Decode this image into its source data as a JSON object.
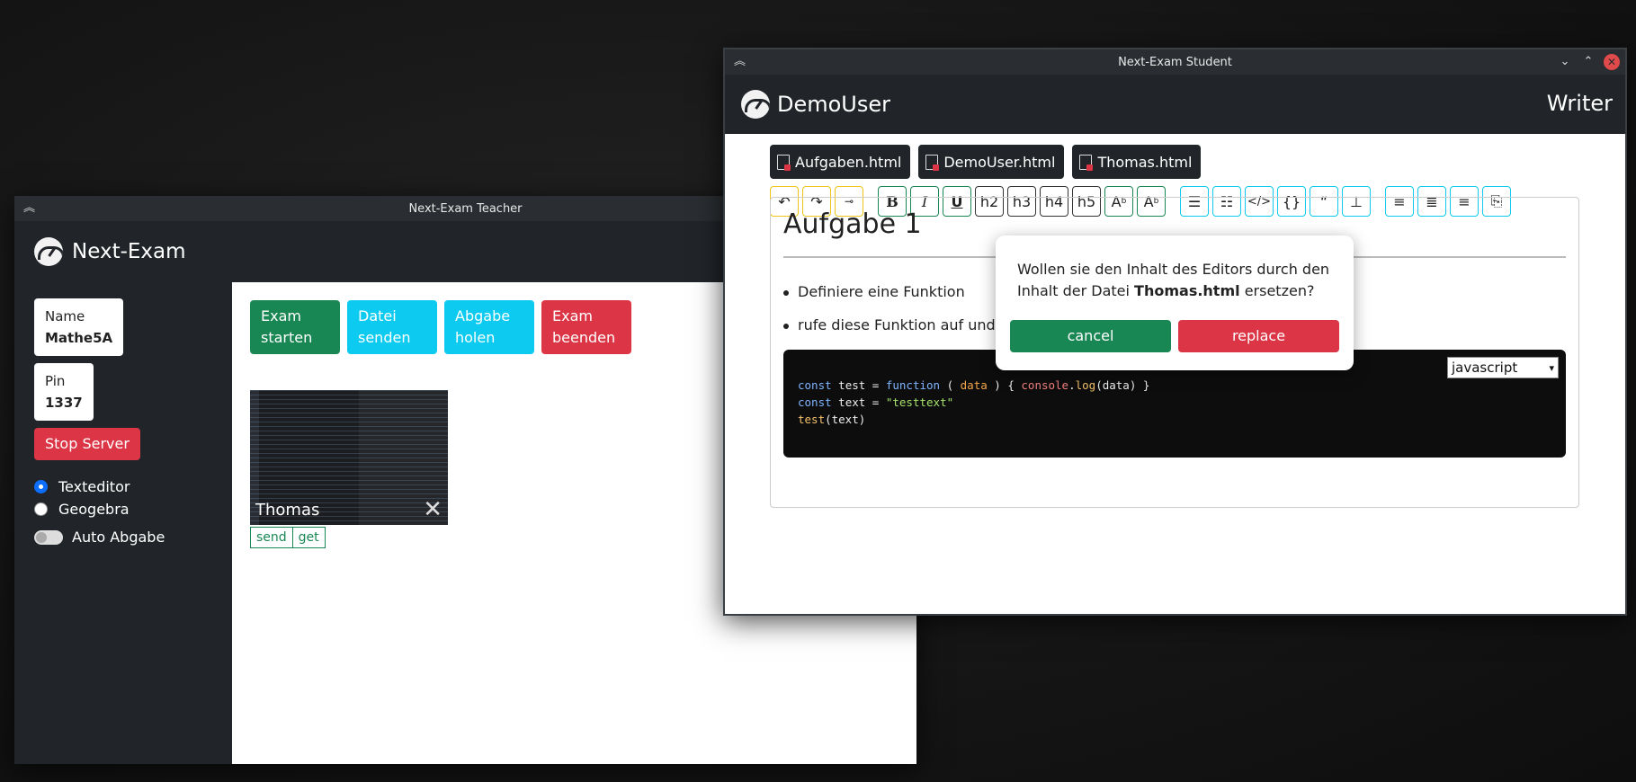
{
  "teacher": {
    "window_title": "Next-Exam Teacher",
    "app_name": "Next-Exam",
    "name_label": "Name",
    "name_value": "Mathe5A",
    "pin_label": "Pin",
    "pin_value": "1337",
    "stop_server": "Stop Server",
    "modes": [
      {
        "label": "Texteditor",
        "selected": true
      },
      {
        "label": "Geogebra",
        "selected": false
      }
    ],
    "auto_abgabe": "Auto Abgabe",
    "actions": {
      "start": "Exam starten",
      "send": "Datei senden",
      "collect": "Abgabe holen",
      "end": "Exam beenden"
    },
    "student": {
      "name": "Thomas",
      "send": "send",
      "get": "get"
    }
  },
  "student": {
    "window_title": "Next-Exam Student",
    "user": "DemoUser",
    "mode": "Writer",
    "files": [
      "Aufgaben.html",
      "DemoUser.html",
      "Thomas.html"
    ],
    "toolbar": [
      "undo",
      "redo",
      "clear-format",
      "bold",
      "italic",
      "underline",
      "h2",
      "h3",
      "h4",
      "h5",
      "subscript",
      "superscript",
      "bullet-list",
      "ordered-list",
      "code",
      "code-block",
      "blockquote",
      "horizontal-rule",
      "align-left",
      "align-center",
      "align-right",
      "page-break"
    ],
    "toolbar_text": {
      "h2": "h2",
      "h3": "h3",
      "h4": "h4",
      "h5": "h5",
      "bold": "B",
      "italic": "I",
      "underline": "U",
      "code_block": "{}",
      "quote": "“"
    },
    "editor": {
      "heading": "Aufgabe 1",
      "items": [
        "Definiere eine Funktion",
        "rufe diese Funktion auf und übergib ihr einen Parameter"
      ],
      "code_language": "javascript"
    },
    "dialog": {
      "text_before": "Wollen sie den Inhalt des Editors durch den Inhalt der Datei ",
      "filename": "Thomas.html",
      "text_after": " ersetzen?",
      "cancel": "cancel",
      "replace": "replace"
    }
  },
  "colors": {
    "green": "#198754",
    "cyan": "#0dcaf0",
    "red": "#dc3545",
    "dark": "#212529"
  }
}
